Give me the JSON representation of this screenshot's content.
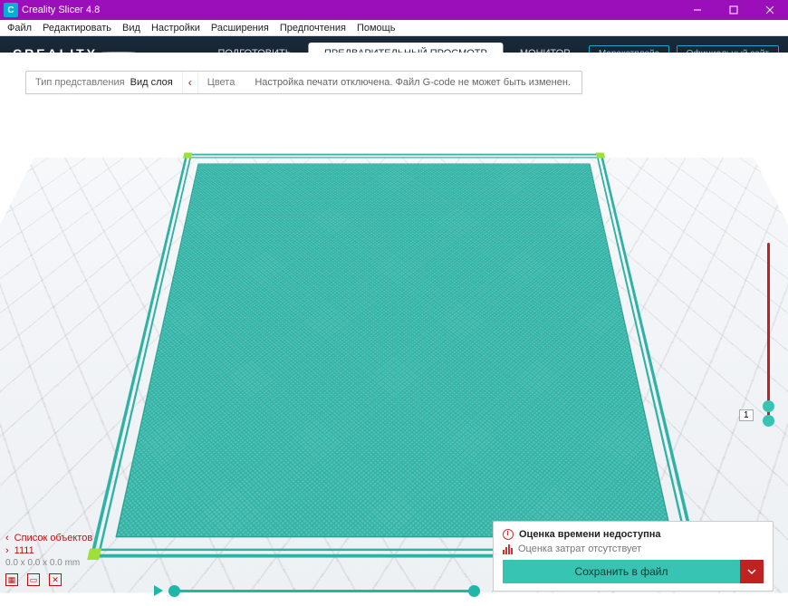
{
  "window": {
    "title": "Creality Slicer 4.8"
  },
  "menus": [
    "Файл",
    "Редактировать",
    "Вид",
    "Настройки",
    "Расширения",
    "Предпочтения",
    "Помощь"
  ],
  "logo": "CREALITY",
  "nav": {
    "prepare": "ПОДГОТОВИТЬ",
    "preview": "ПРЕДВАРИТЕЛЬНЫЙ ПРОСМОТР",
    "monitor": "МОНИТОР"
  },
  "header_buttons": {
    "marketplace": "Марекетплейс",
    "official": "Официальный сайт"
  },
  "subbar": {
    "view_type_label": "Тип представления",
    "view_type_value": "Вид слоя",
    "color_label": "Цвета",
    "message": "Настройка печати отключена. Файл G-code не может быть изменен."
  },
  "objects": {
    "header": "Список объектов",
    "name": "1111",
    "dims": "0.0 x 0.0 x 0.0 mm"
  },
  "infobox": {
    "time_title": "Оценка времени недоступна",
    "cost_title": "Оценка затрат отсутствует",
    "save_label": "Сохранить в файл"
  },
  "layer_slider": {
    "value": "1"
  },
  "colors": {
    "accent_teal": "#37c4b3",
    "accent_red": "#c02222",
    "header_bg": "#14202c",
    "title_purple": "#9b0fba"
  }
}
